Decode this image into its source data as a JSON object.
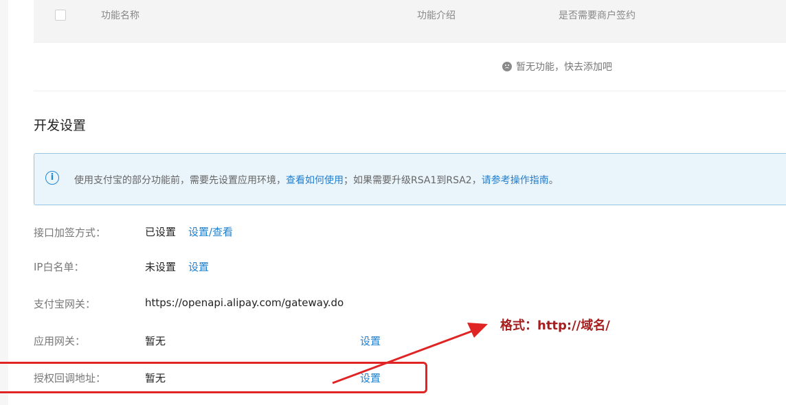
{
  "table": {
    "headers": [
      "功能名称",
      "功能介绍",
      "是否需要商户签约"
    ],
    "empty_text": "暂无功能，快去添加吧"
  },
  "dev_settings": {
    "title": "开发设置",
    "notice": {
      "text_before": "使用支付宝的部分功能前，需要先设置应用环境，",
      "link1": "查看如何使用",
      "text_middle": "；如果需要升级RSA1到RSA2，",
      "link2": "请参考操作指南",
      "text_after": "。"
    },
    "rows": [
      {
        "label": "接口加签方式：",
        "value": "已设置",
        "action": "设置/查看"
      },
      {
        "label": "IP白名单：",
        "value": "未设置",
        "action": "设置"
      },
      {
        "label": "支付宝网关：",
        "value": "https://openapi.alipay.com/gateway.do"
      },
      {
        "label": "应用网关：",
        "value": "暂无",
        "action": "设置"
      },
      {
        "label": "授权回调地址：",
        "value": "暂无",
        "action": "设置"
      }
    ]
  },
  "annotation": {
    "text": "格式：http://域名/",
    "color": "#e02424"
  },
  "colors": {
    "link": "#1f7fcf",
    "alert_bg": "#eaf4fb",
    "alert_border": "#99c5e3"
  }
}
